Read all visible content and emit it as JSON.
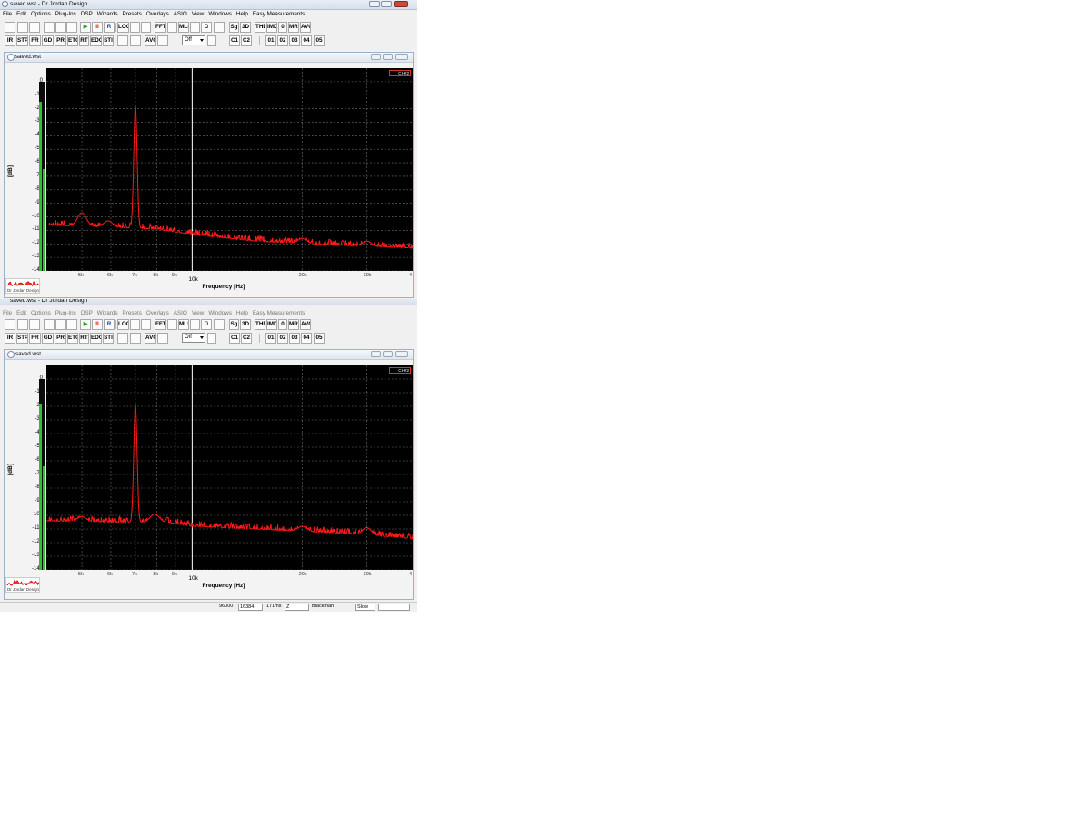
{
  "window_title": "saved.wst - Dr Jordan Design",
  "menu": [
    "File",
    "Edit",
    "Options",
    "Plug-Ins",
    "DSP",
    "Wizards",
    "Presets",
    "Overlays",
    "ASIO",
    "View",
    "Windows",
    "Help",
    "Easy Measurements"
  ],
  "toolbar1": {
    "buttons": [
      "LOG",
      "FFT",
      "MLS",
      "Sg",
      "3D",
      "THD",
      "IMD",
      "0",
      "MRK",
      "AVG"
    ],
    "play_glyph": "▶",
    "pause_glyph": "II",
    "record_label": "R",
    "omega_label": "Ω"
  },
  "toolbar2": {
    "buttons": [
      "IR",
      "STP",
      "FR",
      "GD",
      "PR",
      "ETC",
      "RT",
      "EDC",
      "STI"
    ],
    "avg_label": "AVG",
    "dropdown_value": "Off",
    "channel_buttons": [
      "C1",
      "C2"
    ],
    "overlay_buttons": [
      "01",
      "02",
      "03",
      "04",
      "05"
    ]
  },
  "child_window_title": "saved.wst",
  "legend_label": "CH#2",
  "student_notice": "Student version. Not for commercial use.",
  "logo_text": "Dr Jordan Design",
  "chart_axes": {
    "y_label": "[dB]",
    "x_label": "Frequency [Hz]",
    "y_ticks": [
      "0",
      "-10",
      "-20",
      "-30",
      "-40",
      "-50",
      "-60",
      "-70",
      "-80",
      "-90",
      "-100",
      "-110",
      "-120",
      "-130",
      "-140"
    ],
    "x_ticks": [
      "5k",
      "6k",
      "7k",
      "8k",
      "9k",
      "10k",
      "20k",
      "30k",
      "4"
    ]
  },
  "status_bar": {
    "sample_rate": "96000",
    "fft_size": "16384",
    "window_len": "171ms",
    "z": "Z",
    "window_type": "Blackman",
    "speed": "Slow"
  },
  "colors": {
    "trace": "#ff1a1a",
    "plot_bg": "#000000",
    "meter": "#2fbf2f",
    "marker": "#ffffff"
  },
  "chart_data": [
    {
      "type": "line",
      "name": "top",
      "xlabel": "Frequency [Hz]",
      "ylabel": "[dB]",
      "ylim": [
        -140,
        10
      ],
      "x_scale": "log",
      "x_range": [
        4000,
        40000
      ],
      "grid": true,
      "legend_placement": "top-right",
      "cursor_x": 10000,
      "meter_level_db": [
        -15,
        -65
      ],
      "peaks": [
        {
          "x": 5000,
          "y": -97
        },
        {
          "x": 5900,
          "y": -103
        },
        {
          "x": 7000,
          "y": -17
        },
        {
          "x": 20000,
          "y": -116
        },
        {
          "x": 30000,
          "y": -118
        }
      ],
      "floor": [
        {
          "x": 4000,
          "y": -106
        },
        {
          "x": 6500,
          "y": -108
        },
        {
          "x": 8000,
          "y": -109
        },
        {
          "x": 10000,
          "y": -113
        },
        {
          "x": 15000,
          "y": -118
        },
        {
          "x": 25000,
          "y": -121
        },
        {
          "x": 40000,
          "y": -123
        }
      ]
    },
    {
      "type": "line",
      "name": "bottom",
      "xlabel": "Frequency [Hz]",
      "ylabel": "[dB]",
      "ylim": [
        -140,
        10
      ],
      "x_scale": "log",
      "x_range": [
        4000,
        40000
      ],
      "grid": true,
      "legend_placement": "top-right",
      "cursor_x": 10000,
      "meter_level_db": [
        -18,
        -64
      ],
      "peaks": [
        {
          "x": 5000,
          "y": -101
        },
        {
          "x": 7000,
          "y": -18
        },
        {
          "x": 7900,
          "y": -99
        },
        {
          "x": 20000,
          "y": -108
        },
        {
          "x": 30000,
          "y": -109
        }
      ],
      "floor": [
        {
          "x": 4000,
          "y": -104
        },
        {
          "x": 6500,
          "y": -105
        },
        {
          "x": 8500,
          "y": -105
        },
        {
          "x": 10000,
          "y": -108
        },
        {
          "x": 15000,
          "y": -110
        },
        {
          "x": 25000,
          "y": -113
        },
        {
          "x": 40000,
          "y": -117
        }
      ]
    }
  ]
}
